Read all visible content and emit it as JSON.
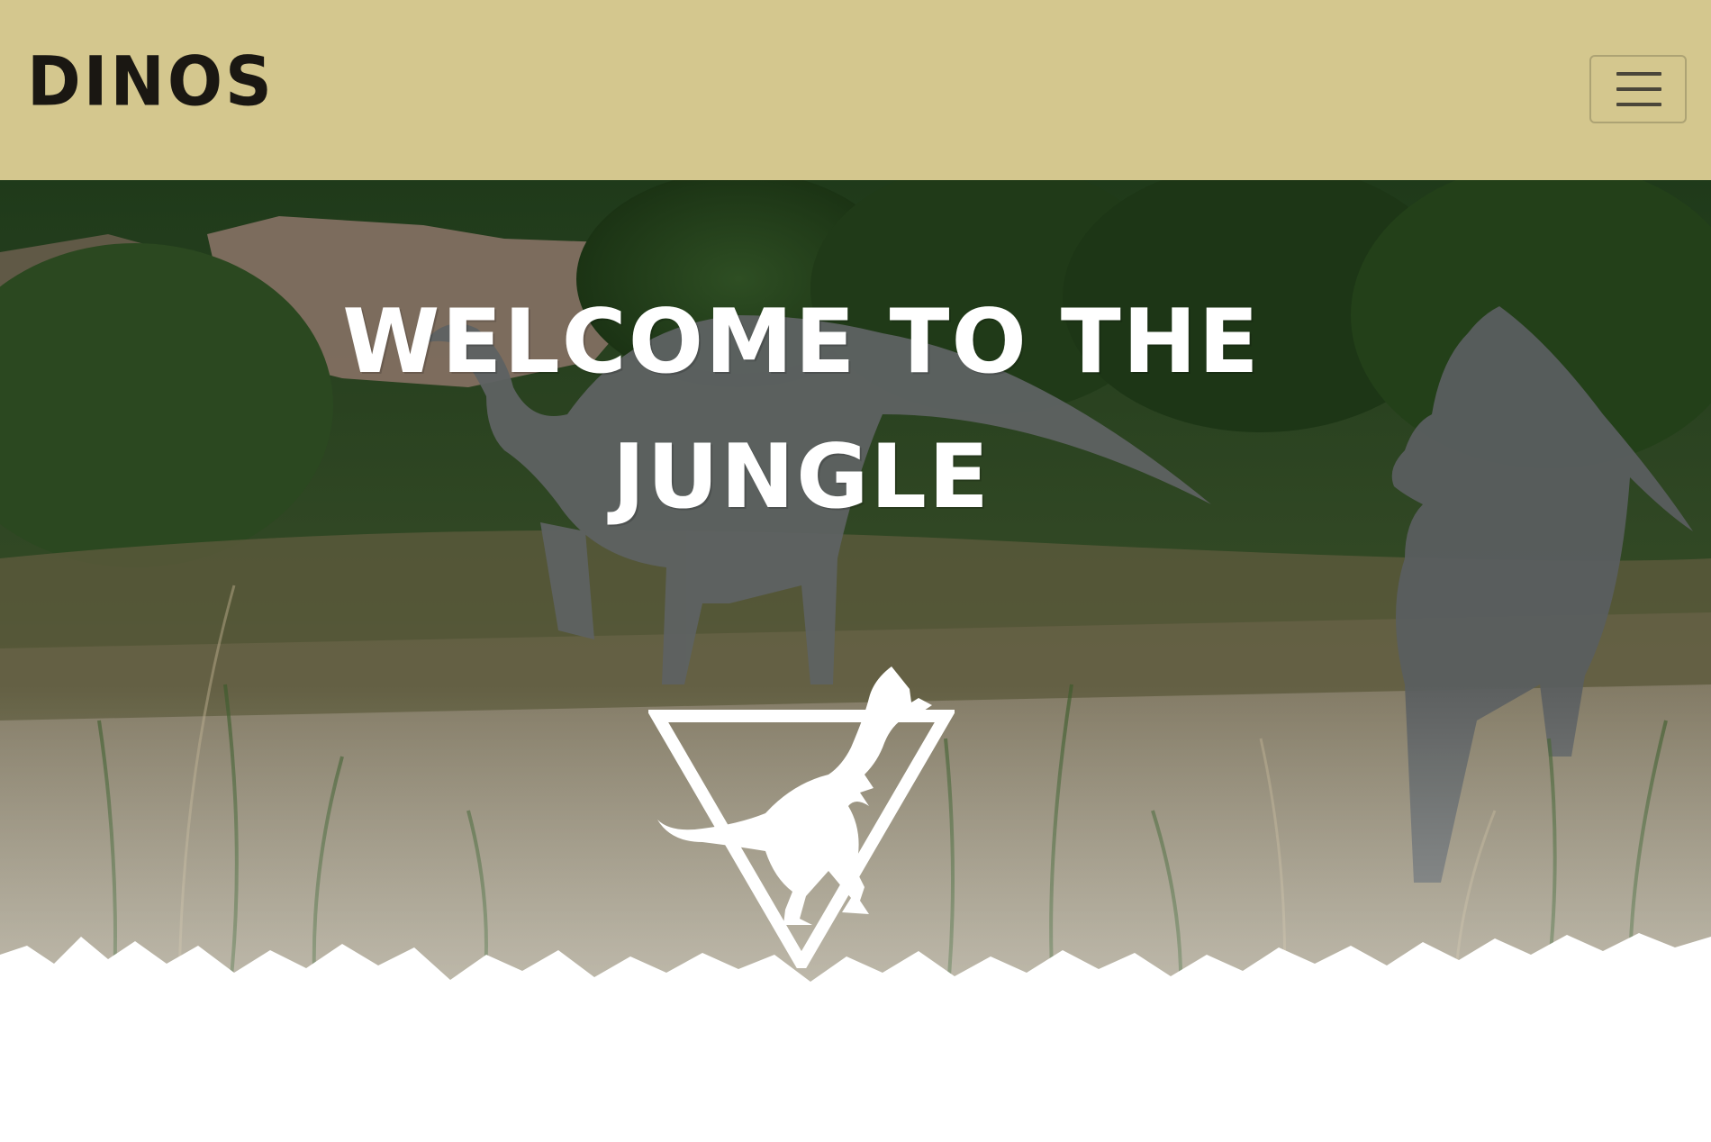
{
  "navbar": {
    "brand": "DINOS",
    "toggler_icon": "hamburger-menu-icon",
    "background_color": "#d4c78e"
  },
  "hero": {
    "title_line1": "WELCOME TO THE",
    "title_line2": "JUNGLE",
    "logo_icon": "t-rex-triangle-logo-icon",
    "background_image": "dinosaurs-in-grassy-jungle"
  }
}
